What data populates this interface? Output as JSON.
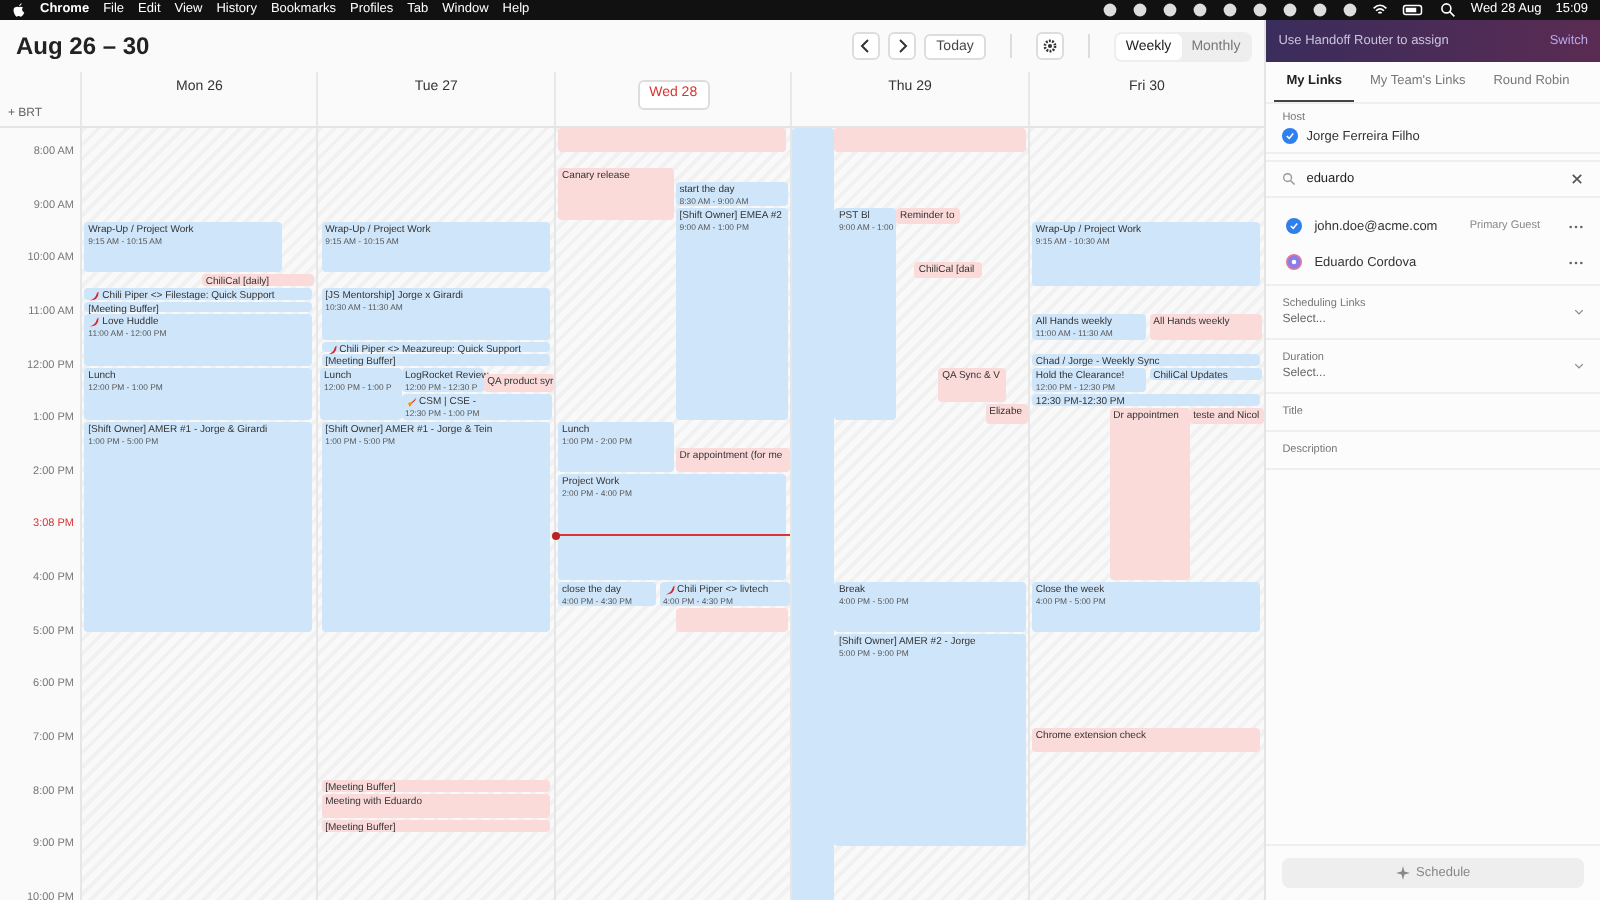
{
  "menu_bar": {
    "app": "Chrome",
    "menus": [
      "File",
      "Edit",
      "View",
      "History",
      "Bookmarks",
      "Profiles",
      "Tab",
      "Window",
      "Help"
    ],
    "date": "Wed 28 Aug",
    "time": "15:09"
  },
  "header": {
    "title": "Aug 26 – 30",
    "today_button": "Today",
    "views": [
      {
        "label": "Weekly",
        "selected": true
      },
      {
        "label": "Monthly",
        "selected": false
      }
    ]
  },
  "timezone": "+ BRT",
  "time_labels": [
    {
      "label": "8:00 AM",
      "current": false
    },
    {
      "label": "9:00 AM",
      "current": false
    },
    {
      "label": "10:00 AM",
      "current": false
    },
    {
      "label": "11:00 AM",
      "current": false
    },
    {
      "label": "12:00 PM",
      "current": false
    },
    {
      "label": "1:00 PM",
      "current": false
    },
    {
      "label": "2:00 PM",
      "current": false
    },
    {
      "label": "3:08 PM",
      "current": true
    },
    {
      "label": "4:00 PM",
      "current": false
    },
    {
      "label": "5:00 PM",
      "current": false
    },
    {
      "label": "6:00 PM",
      "current": false
    },
    {
      "label": "7:00 PM",
      "current": false
    },
    {
      "label": "8:00 PM",
      "current": false
    },
    {
      "label": "9:00 PM",
      "current": false
    },
    {
      "label": "10:00 PM",
      "current": false
    }
  ],
  "days": [
    {
      "label": "Mon 26",
      "today": false,
      "events": [
        {
          "kind": "event",
          "title": "Wrap-Up / Project Work",
          "time": "9:15 AM - 10:15 AM",
          "color": "#cfe6fa"
        },
        {
          "kind": "event",
          "title": "ChiliCal [daily]",
          "color": "#fbdada"
        },
        {
          "kind": "booking",
          "title": "Chili Piper <> Filestage: Quick Support",
          "color": "#cfe6fa"
        },
        {
          "kind": "event",
          "title": "[Meeting Buffer]",
          "color": "#cfe6fa"
        },
        {
          "kind": "booking",
          "title": "Love Huddle",
          "time": "11:00 AM - 12:00 PM",
          "color": "#cfe6fa"
        },
        {
          "kind": "event",
          "title": "Lunch",
          "time": "12:00 PM - 1:00 PM",
          "color": "#cfe6fa"
        },
        {
          "kind": "event",
          "title": "[Shift Owner] AMER #1 - Jorge & Girardi",
          "time": "1:00 PM - 5:00 PM",
          "color": "#cfe6fa"
        }
      ]
    },
    {
      "label": "Tue 27",
      "today": false,
      "events": [
        {
          "kind": "event",
          "title": "Wrap-Up / Project Work",
          "time": "9:15 AM - 10:15 AM",
          "color": "#cfe6fa"
        },
        {
          "kind": "event",
          "title": "[JS Mentorship] Jorge x Girardi",
          "time": "10:30 AM - 11:30 AM",
          "color": "#cfe6fa"
        },
        {
          "kind": "booking",
          "title": "Chili Piper <> Meazureup: Quick Support",
          "color": "#cfe6fa"
        },
        {
          "kind": "event",
          "title": "[Meeting Buffer]",
          "color": "#cfe6fa"
        },
        {
          "kind": "event",
          "title": "Lunch",
          "time": "12:00 PM - 1:00 P",
          "color": "#cfe6fa"
        },
        {
          "kind": "event",
          "title": "LogRocket Review",
          "time": "12:00 PM - 12:30 P",
          "color": "#cfe6fa"
        },
        {
          "kind": "launch",
          "title": "CSM | CSE -",
          "time": "12:30 PM - 1:00 PM",
          "color": "#cfe6fa"
        },
        {
          "kind": "event",
          "title": "QA product syr",
          "color": "#fbdada"
        },
        {
          "kind": "event",
          "title": "[Shift Owner] AMER #1 - Jorge & Tein",
          "time": "1:00 PM - 5:00 PM",
          "color": "#cfe6fa"
        },
        {
          "kind": "event",
          "title": "[Meeting Buffer]",
          "color": "#fbdada"
        },
        {
          "kind": "event",
          "title": "Meeting with Eduardo",
          "color": "#fbdada"
        },
        {
          "kind": "event",
          "title": "[Meeting Buffer]",
          "color": "#fbdada"
        }
      ]
    },
    {
      "label": "Wed 28",
      "today": true,
      "events": [
        {
          "kind": "block",
          "color": "#fbdada"
        },
        {
          "kind": "event",
          "title": "Canary release",
          "color": "#fbdada"
        },
        {
          "kind": "event",
          "title": "start the day",
          "time": "8:30 AM - 9:00 AM",
          "color": "#cfe6fa"
        },
        {
          "kind": "event",
          "title": "[Shift Owner] EMEA #2",
          "time": "9:00 AM - 1:00 PM",
          "color": "#cfe6fa"
        },
        {
          "kind": "event",
          "title": "Lunch",
          "time": "1:00 PM - 2:00 PM",
          "color": "#cfe6fa"
        },
        {
          "kind": "event",
          "title": "Dr appointment (for me",
          "color": "#fbdada"
        },
        {
          "kind": "event",
          "title": "Project Work",
          "time": "2:00 PM - 4:00 PM",
          "color": "#cfe6fa"
        },
        {
          "kind": "event",
          "title": "close the day",
          "time": "4:00 PM - 4:30 PM",
          "color": "#cfe6fa"
        },
        {
          "kind": "booking",
          "title": "Chili Piper <> livtech",
          "time": "4:00 PM - 4:30 PM",
          "color": "#cfe6fa"
        },
        {
          "kind": "block",
          "color": "#fbdada"
        }
      ]
    },
    {
      "label": "Thu 29",
      "today": false,
      "events": [
        {
          "kind": "block",
          "color": "#cfe6fa"
        },
        {
          "kind": "block",
          "color": "#fbdada"
        },
        {
          "kind": "event",
          "title": "PST Bl",
          "time": "9:00 AM - 1:00",
          "color": "#cfe6fa"
        },
        {
          "kind": "event",
          "title": "Reminder to",
          "color": "#fbdada"
        },
        {
          "kind": "event",
          "title": "ChiliCal [dail",
          "color": "#fbdada"
        },
        {
          "kind": "event",
          "title": "QA Sync & V",
          "color": "#fbdada"
        },
        {
          "kind": "event",
          "title": "Elizabe",
          "color": "#fbdada"
        },
        {
          "kind": "event",
          "title": "Break",
          "time": "4:00 PM - 5:00 PM",
          "color": "#cfe6fa"
        },
        {
          "kind": "event",
          "title": "[Shift Owner] AMER #2 - Jorge",
          "time": "5:00 PM - 9:00 PM",
          "color": "#cfe6fa"
        }
      ]
    },
    {
      "label": "Fri 30",
      "today": false,
      "events": [
        {
          "kind": "event",
          "title": "Wrap-Up / Project Work",
          "time": "9:15 AM - 10:30 AM",
          "color": "#cfe6fa"
        },
        {
          "kind": "event",
          "title": "All Hands weekly",
          "time": "11:00 AM - 11:30 AM",
          "color": "#cfe6fa"
        },
        {
          "kind": "event",
          "title": "All Hands weekly",
          "color": "#fbdada"
        },
        {
          "kind": "event",
          "title": "Chad / Jorge - Weekly Sync",
          "color": "#cfe6fa"
        },
        {
          "kind": "event",
          "title": "Hold the Clearance!",
          "time": "12:00 PM - 12:30 PM",
          "color": "#cfe6fa"
        },
        {
          "kind": "event",
          "title": "ChiliCal Updates",
          "color": "#cfe6fa"
        },
        {
          "kind": "event",
          "title": "12:30 PM-12:30 PM",
          "color": "#cfe6fa"
        },
        {
          "kind": "event",
          "title": "Dr appointmen",
          "color": "#fbdada"
        },
        {
          "kind": "event",
          "title": "teste and Nicol",
          "color": "#fbdada"
        },
        {
          "kind": "event",
          "title": "Close the week",
          "time": "4:00 PM - 5:00 PM",
          "color": "#cfe6fa"
        },
        {
          "kind": "event",
          "title": "Chrome extension check",
          "color": "#fbdada"
        }
      ]
    }
  ],
  "panel": {
    "banner": "Use Handoff Router to assign",
    "banner_action": "Switch",
    "tabs": [
      {
        "label": "My Links",
        "selected": true
      },
      {
        "label": "My Team's Links",
        "selected": false
      },
      {
        "label": "Round Robin",
        "selected": false
      }
    ],
    "host_label": "Host",
    "host": "Jorge  Ferreira Filho",
    "search": {
      "value": "eduardo"
    },
    "guests": [
      {
        "kind": "email",
        "name": "john.doe@acme.com",
        "role": "Primary Guest"
      },
      {
        "kind": "person",
        "name": "Eduardo Cordova"
      }
    ],
    "fields": [
      {
        "kind": "select",
        "label": "Scheduling Links",
        "placeholder": "Select..."
      },
      {
        "kind": "select",
        "label": "Duration",
        "placeholder": "Select..."
      },
      {
        "kind": "text",
        "label": "Title"
      },
      {
        "kind": "text",
        "label": "Description"
      }
    ],
    "schedule_button": {
      "label": "Schedule",
      "disabled": true
    }
  }
}
